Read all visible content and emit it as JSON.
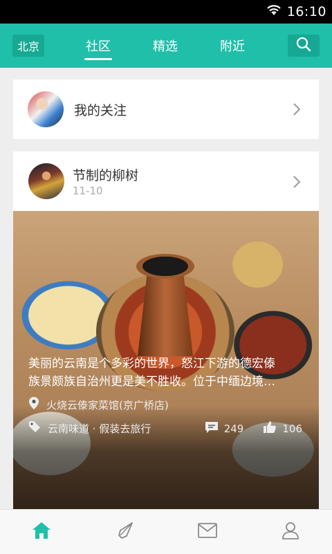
{
  "status_bar": {
    "time": "16:10",
    "icons": [
      "wifi-icon"
    ]
  },
  "app_bar": {
    "city": "北京",
    "tabs": [
      {
        "label": "社区",
        "active": true
      },
      {
        "label": "精选",
        "active": false
      },
      {
        "label": "附近",
        "active": false
      }
    ],
    "accent_color": "#1fbfa9",
    "search_icon": "search-icon"
  },
  "follow_card": {
    "label": "我的关注"
  },
  "post": {
    "author": "节制的柳树",
    "date": "11-10",
    "text_lines": [
      "美丽的云南是个多彩的世界，怒江下游的德宏傣",
      "族景颇族自治州更是美不胜收。位于中缅边境…"
    ],
    "location": "火烧云傣家菜馆(京广桥店)",
    "tags": "云南味道 · 假装去旅行",
    "comments": "249",
    "likes": "106"
  },
  "bottom_nav": {
    "items": [
      "home-icon",
      "compass-icon",
      "mail-icon",
      "profile-icon"
    ],
    "active_index": 0
  }
}
